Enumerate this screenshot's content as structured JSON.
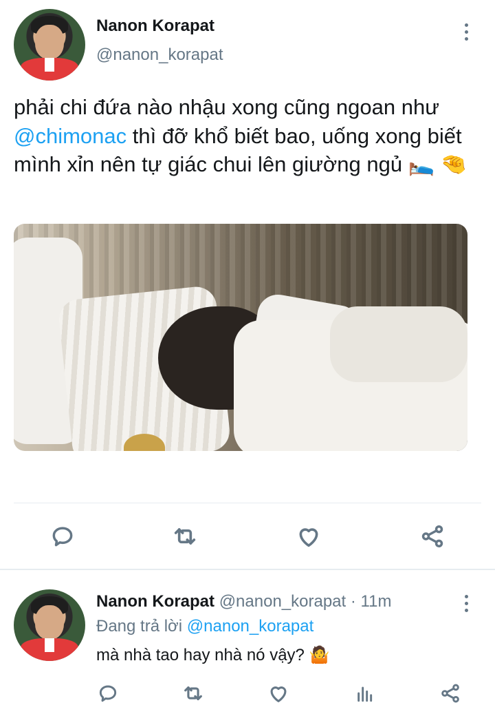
{
  "main_tweet": {
    "author_name": "Nanon Korapat",
    "author_handle": "@nanon_korapat",
    "text_before": "phải chi đứa nào nhậu xong cũng ngoan như ",
    "mention": "@chimonac",
    "text_after": " thì đỡ khổ biết bao, uống xong biết mình xỉn nên tự giác chui lên giường ngủ 🛌 🤏",
    "more_icon": "more-vertical-icon",
    "actions": [
      "reply-icon",
      "retweet-icon",
      "like-icon",
      "share-icon"
    ]
  },
  "reply_tweet": {
    "author_name": "Nanon Korapat",
    "author_handle": "@nanon_korapat",
    "separator": "·",
    "time": "11m",
    "replying_label": "Đang trả lời",
    "replying_to": "@nanon_korapat",
    "text": "mà nhà tao hay nhà nó vậy? 🤷",
    "more_icon": "more-vertical-icon",
    "actions": [
      "reply-icon",
      "retweet-icon",
      "like-icon",
      "analytics-icon",
      "share-icon"
    ]
  },
  "colors": {
    "text": "#14171a",
    "secondary": "#657786",
    "accent": "#1da1f2",
    "divider": "#e6ecf0"
  }
}
